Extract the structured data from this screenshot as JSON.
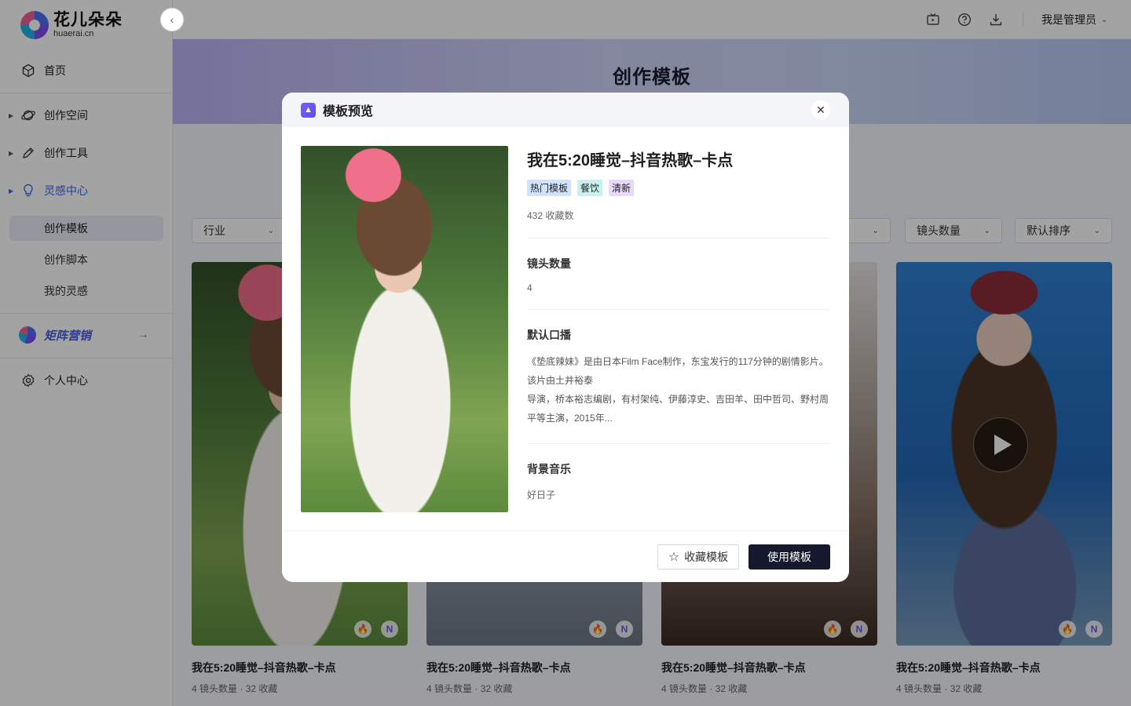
{
  "brand": {
    "name_cn": "花儿朵朵",
    "domain": "huaerai.cn"
  },
  "sidebar": {
    "home": "首页",
    "creation_space": "创作空间",
    "creation_tools": "创作工具",
    "inspiration_center": "灵感中心",
    "sub_items": [
      "创作模板",
      "创作脚本",
      "我的灵感"
    ],
    "matrix_marketing": "矩阵营销",
    "personal_center": "个人中心"
  },
  "topbar": {
    "user": "我是管理员"
  },
  "page": {
    "title": "创作模板"
  },
  "filters": [
    "行业",
    "镜头数量",
    "默认排序"
  ],
  "cards": [
    {
      "title": "我在5:20睡觉–抖音热歌–卡点",
      "shots": "4 镜头数量",
      "favorites": "32 收藏",
      "sep": "·"
    },
    {
      "title": "我在5:20睡觉–抖音热歌–卡点",
      "shots": "4 镜头数量",
      "favorites": "32 收藏",
      "sep": "·"
    },
    {
      "title": "我在5:20睡觉–抖音热歌–卡点",
      "shots": "4 镜头数量",
      "favorites": "32 收藏",
      "sep": "·"
    },
    {
      "title": "我在5:20睡觉–抖音热歌–卡点",
      "shots": "4 镜头数量",
      "favorites": "32 收藏",
      "sep": "·"
    }
  ],
  "badges": {
    "n": "N"
  },
  "modal": {
    "title": "模板预览",
    "template_title": "我在5:20睡觉–抖音热歌–卡点",
    "tags": [
      "热门模板",
      "餐饮",
      "清新"
    ],
    "favorite_count": "432 收藏数",
    "shots_label": "镜头数量",
    "shots_value": "4",
    "narration_label": "默认口播",
    "narration_lines": [
      "《垫底辣妹》是由日本Film Face制作，东宝发行的117分钟的剧情影片。",
      "该片由土井裕泰",
      "导演，桥本裕志编剧，有村架纯、伊藤淳史、吉田羊、田中哲司、野村周",
      "平等主演，2015年..."
    ],
    "music_label": "背景音乐",
    "music_value": "好日子",
    "fav_button": "收藏模板",
    "use_button": "使用模板"
  },
  "colors": {
    "accent": "#3a64f0",
    "primary_button": "#15192b",
    "overlay": "rgba(0,0,0,0.36)"
  }
}
